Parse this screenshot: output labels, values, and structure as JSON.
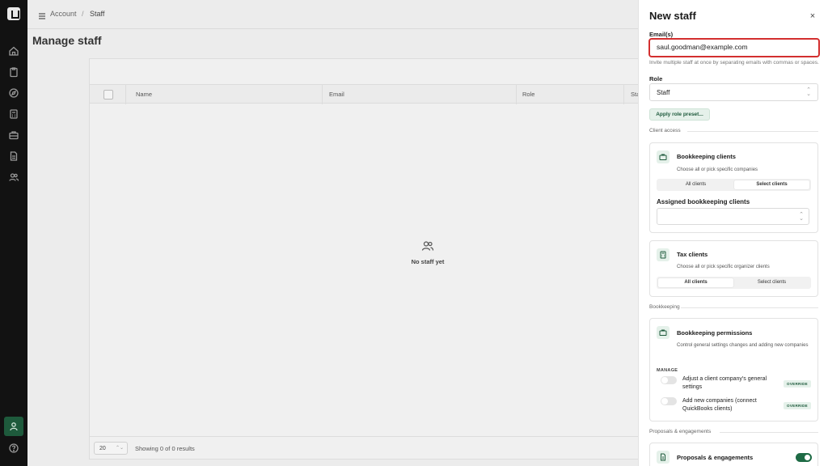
{
  "breadcrumb": {
    "parent": "Account",
    "separator": "/",
    "current": "Staff"
  },
  "page": {
    "title": "Manage staff"
  },
  "table": {
    "columns": [
      "Name",
      "Email",
      "Role",
      "Sta"
    ],
    "empty_text": "No staff yet",
    "page_size": "20",
    "showing_text": "Showing 0 of 0 results"
  },
  "drawer": {
    "title": "New staff",
    "close_glyph": "×",
    "emails_label": "Email(s)",
    "emails_value": "saul.goodman@example.com",
    "emails_hint": "Invite multiple staff at once by separating emails with commas or spaces.",
    "role_label": "Role",
    "role_value": "Staff",
    "apply_preset_label": "Apply role preset...",
    "client_access_label": "Client access",
    "bookkeeping_clients": {
      "title": "Bookkeeping clients",
      "subtitle": "Choose all or pick specific companies",
      "option_all": "All clients",
      "option_select": "Select clients",
      "selected": "Select clients",
      "assigned_label": "Assigned bookkeeping clients"
    },
    "tax_clients": {
      "title": "Tax clients",
      "subtitle": "Choose all or pick specific organizer clients",
      "option_all": "All clients",
      "option_select": "Select clients",
      "selected": "All clients"
    },
    "bookkeeping_section_label": "Bookkeeping",
    "bookkeeping_permissions": {
      "title": "Bookkeeping permissions",
      "subtitle": "Control general settings changes and adding new companies",
      "manage_label": "MANAGE",
      "items": [
        {
          "label": "Adjust a client company's general settings",
          "badge": "OVERRIDE",
          "enabled": false
        },
        {
          "label": "Add new companies (connect QuickBooks clients)",
          "badge": "OVERRIDE",
          "enabled": false
        }
      ]
    },
    "proposals_section_label": "Proposals & engagements",
    "proposals": {
      "title": "Proposals & engagements",
      "enabled": true
    }
  },
  "colors": {
    "accent": "#1e5a3c",
    "accent_light": "#e5f1ea",
    "error_border": "#d32f2f",
    "rail": "#121212"
  }
}
